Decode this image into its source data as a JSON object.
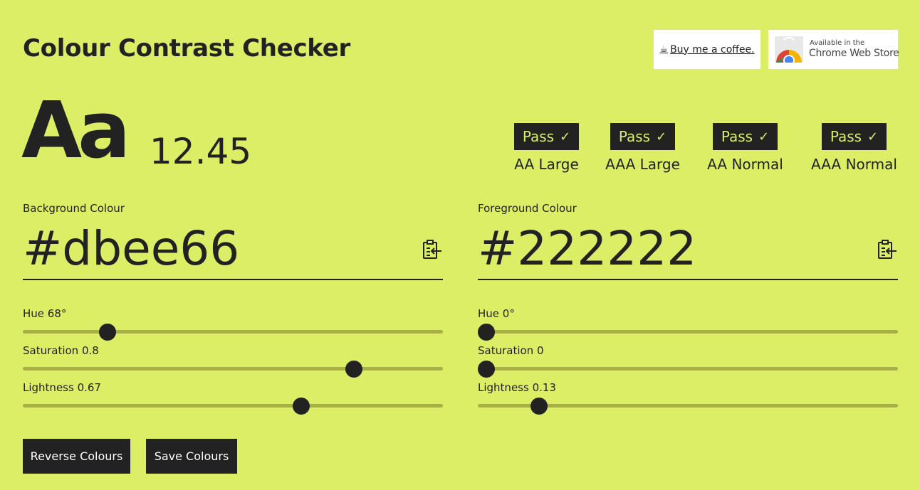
{
  "header": {
    "title": "Colour Contrast Checker",
    "coffee_link": "Buy me a coffee.",
    "store_badge_small": "Available in the",
    "store_badge_big": "Chrome Web Store"
  },
  "preview": {
    "sample_text": "Aa",
    "contrast_ratio": "12.45"
  },
  "results": [
    {
      "status": "Pass",
      "level": "AA Large"
    },
    {
      "status": "Pass",
      "level": "AAA Large"
    },
    {
      "status": "Pass",
      "level": "AA Normal"
    },
    {
      "status": "Pass",
      "level": "AAA Normal"
    }
  ],
  "background": {
    "label": "Background Colour",
    "hex": "#dbee66",
    "hue_label": "Hue 68°",
    "hue": 68,
    "saturation_label": "Saturation 0.8",
    "saturation": 0.8,
    "lightness_label": "Lightness 0.67",
    "lightness": 0.67
  },
  "foreground": {
    "label": "Foreground Colour",
    "hex": "#222222",
    "hue_label": "Hue 0°",
    "hue": 0,
    "saturation_label": "Saturation 0",
    "saturation": 0,
    "lightness_label": "Lightness 0.13",
    "lightness": 0.13
  },
  "actions": {
    "reverse_label": "Reverse Colours",
    "save_label": "Save Colours"
  },
  "colors": {
    "background": "#dbee66",
    "foreground": "#222222",
    "track": "#a6b043"
  },
  "icons": {
    "coffee": "coffee-cup-icon",
    "store": "chrome-store-icon",
    "paste": "clipboard-paste-icon",
    "check": "check-icon"
  }
}
